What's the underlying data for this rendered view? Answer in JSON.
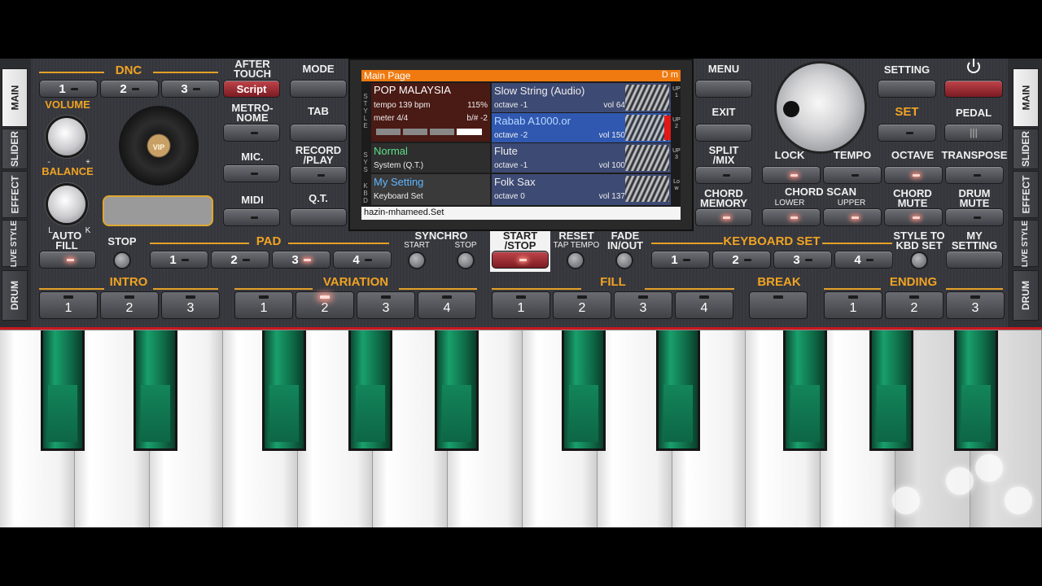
{
  "side_tabs_left": [
    "MAIN",
    "SLIDER",
    "EFFECT",
    "LIVE STYLE",
    "DRUM"
  ],
  "side_tabs_right": [
    "MAIN",
    "SLIDER",
    "EFFECT",
    "LIVE STYLE",
    "DRUM"
  ],
  "dnc": {
    "label": "DNC",
    "buttons": [
      "1",
      "2",
      "3"
    ],
    "script": "Script"
  },
  "after_touch": "AFTER\nTOUCH",
  "metronome": "METRO-\nNOME",
  "mic": "MIC.",
  "midi": "MIDI",
  "volume": "VOLUME",
  "balance": "BALANCE",
  "balance_minus": "-",
  "balance_plus": "+",
  "balance_l": "L",
  "balance_k": "K",
  "vip": "VIP",
  "left_col": {
    "mode": "MODE",
    "tab": "TAB",
    "record": "RECORD\n/PLAY",
    "qt": "Q.T."
  },
  "right_col": {
    "menu": "MENU",
    "exit": "EXIT",
    "split": "SPLIT\n/MIX",
    "chord_memory": "CHORD\nMEMORY"
  },
  "screen": {
    "header": "Main Page",
    "key": "D m",
    "style_tag": "STYLE",
    "sys_tag": "SYS",
    "kbd_tag": "KBD",
    "style_name": "POP MALAYSIA",
    "tempo": "tempo 139 bpm",
    "tempo_pct": "115%",
    "meter": "meter 4/4",
    "transpose": "b/# -2",
    "normal": "Normal",
    "system_qt": "System (Q.T.)",
    "my_setting": "My Setting",
    "keyboard_set": "Keyboard Set",
    "footer": "hazin-mhameed.Set",
    "parts": [
      {
        "name": "Slow String (Audio)",
        "octave": "octave -1",
        "vol": "vol 64",
        "tag": "UP1"
      },
      {
        "name": "Rabab A1000.or",
        "octave": "octave -2",
        "vol": "vol 150",
        "tag": "UP2"
      },
      {
        "name": "Flute",
        "octave": "octave -1",
        "vol": "vol 100",
        "tag": "UP3"
      },
      {
        "name": "Folk Sax",
        "octave": "octave  0",
        "vol": "vol 137",
        "tag": "Low"
      }
    ]
  },
  "setting": "SETTING",
  "set": "SET",
  "pedal": "PEDAL",
  "lock": "LOCK",
  "tempo_lbl": "TEMPO",
  "octave": "OCTAVE",
  "transpose_lbl": "TRANSPOSE",
  "chord_scan": "CHORD SCAN",
  "lower": "LOWER",
  "upper": "UPPER",
  "chord_mute": "CHORD\nMUTE",
  "drum_mute": "DRUM\nMUTE",
  "auto_fill": "AUTO\nFILL",
  "stop": "STOP",
  "pad": {
    "label": "PAD",
    "buttons": [
      "1",
      "2",
      "3",
      "4"
    ]
  },
  "synchro": "SYNCHRO",
  "synchro_start": "START",
  "synchro_stop": "STOP",
  "start_stop": "START\n/STOP",
  "reset": "RESET",
  "tap_tempo": "TAP TEMPO",
  "fade": "FADE\nIN/OUT",
  "keyboard_set_lbl": "KEYBOARD SET",
  "kbd_buttons": [
    "1",
    "2",
    "3",
    "4"
  ],
  "style_to_kbd": "STYLE TO\nKBD SET",
  "my_setting_lbl": "MY\nSETTING",
  "intro": {
    "label": "INTRO",
    "buttons": [
      "1",
      "2",
      "3"
    ]
  },
  "variation": {
    "label": "VARIATION",
    "buttons": [
      "1",
      "2",
      "3",
      "4"
    ]
  },
  "fill": {
    "label": "FILL",
    "buttons": [
      "1",
      "2",
      "3",
      "4"
    ]
  },
  "break": {
    "label": "BREAK"
  },
  "ending": {
    "label": "ENDING",
    "buttons": [
      "1",
      "2",
      "3"
    ]
  },
  "colors": {
    "accent": "#e5a027",
    "key_green": "#19a06c",
    "led_on": "#ff8f80",
    "header_orange": "#f07a10"
  }
}
